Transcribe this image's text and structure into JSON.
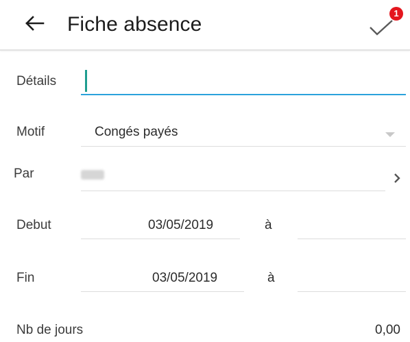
{
  "header": {
    "title": "Fiche absence",
    "validate_badge_count": "1",
    "back_icon": "arrow-left-icon",
    "validate_icon": "check-icon"
  },
  "form": {
    "details": {
      "label": "Détails",
      "value": ""
    },
    "motif": {
      "label": "Motif",
      "value": "Congés payés",
      "icon": "dropdown-triangle-icon"
    },
    "par": {
      "label": "Par",
      "value_redacted": true,
      "icon": "chevron-right-icon"
    },
    "debut": {
      "label": "Debut",
      "date": "03/05/2019",
      "separator": "à",
      "time": ""
    },
    "fin": {
      "label": "Fin",
      "date": "03/05/2019",
      "separator": "à",
      "time": ""
    },
    "nb_jours": {
      "label": "Nb de jours",
      "value": "0,00"
    }
  },
  "colors": {
    "accent_underline": "#2aa2dc",
    "caret": "#1e9d8f",
    "badge": "#e4161e"
  }
}
